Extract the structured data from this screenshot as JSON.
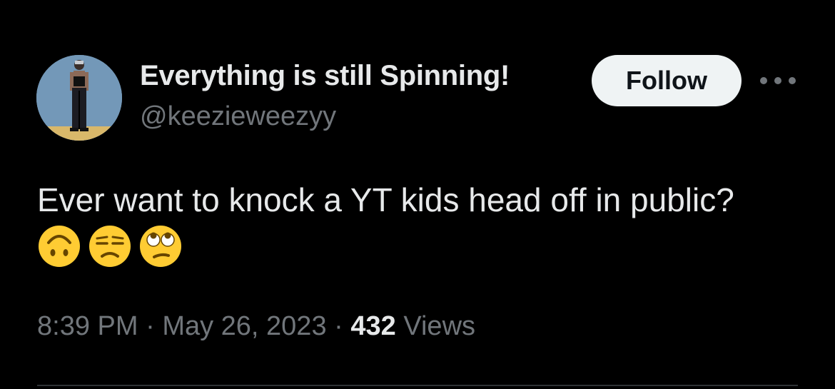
{
  "author": {
    "display_name": "Everything is still Spinning!",
    "handle": "@keezieweezyy"
  },
  "actions": {
    "follow_label": "Follow",
    "more_icon": "more-horizontal-icon"
  },
  "tweet": {
    "text": "Ever want to knock a YT kids head off in public?",
    "emojis": [
      "upside-down-face-emoji",
      "unamused-face-emoji",
      "rolling-eyes-emoji"
    ],
    "time": "8:39 PM",
    "date": "May 26, 2023",
    "views_count": "432",
    "views_label": "Views"
  },
  "colors": {
    "background": "#000000",
    "primary_text": "#e7e9ea",
    "secondary_text": "#71767b",
    "follow_bg": "#eff3f4",
    "divider": "#2f3336"
  }
}
